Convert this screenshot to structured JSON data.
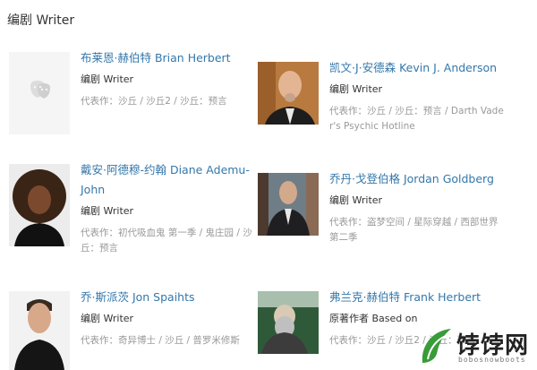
{
  "section": {
    "title": "编剧 Writer"
  },
  "people": [
    {
      "name": "布莱恩·赫伯特 Brian Herbert",
      "role": "编剧 Writer",
      "works_label": "代表作：",
      "works": "沙丘 / 沙丘2 / 沙丘：预言",
      "photo": "placeholder-masks-icon"
    },
    {
      "name": "凯文·J·安德森 Kevin J. Anderson",
      "role": "编剧 Writer",
      "works_label": "代表作：",
      "works": "沙丘 / 沙丘：预言 / Darth Vader's Psychic Hotline",
      "photo": "portrait-bald-man-goatee"
    },
    {
      "name": "戴安·阿德穆-约翰 Diane Ademu-John",
      "role": "编剧 Writer",
      "works_label": "代表作：",
      "works": "初代吸血鬼 第一季 / 鬼庄园 / 沙丘：预言",
      "photo": "portrait-woman-curly-hair"
    },
    {
      "name": "乔丹·戈登伯格 Jordan Goldberg",
      "role": "编剧 Writer",
      "works_label": "代表作：",
      "works": "盗梦空间 / 星际穿越 / 西部世界 第二季",
      "photo": "portrait-man-suit-street"
    },
    {
      "name": "乔·斯派茨 Jon Spaihts",
      "role": "编剧 Writer",
      "works_label": "代表作：",
      "works": "奇异博士 / 沙丘 / 普罗米修斯",
      "photo": "portrait-man-black-shirt"
    },
    {
      "name": "弗兰克·赫伯特 Frank Herbert",
      "role": "原著作者 Based on",
      "works_label": "代表作：",
      "works": "沙丘 / 沙丘2 / 沙丘：预言",
      "photo": "portrait-bearded-man-green"
    }
  ],
  "watermark": {
    "text": "饽饽网",
    "sub": "bobosnowboots",
    "accent": "#3a9b3a"
  }
}
